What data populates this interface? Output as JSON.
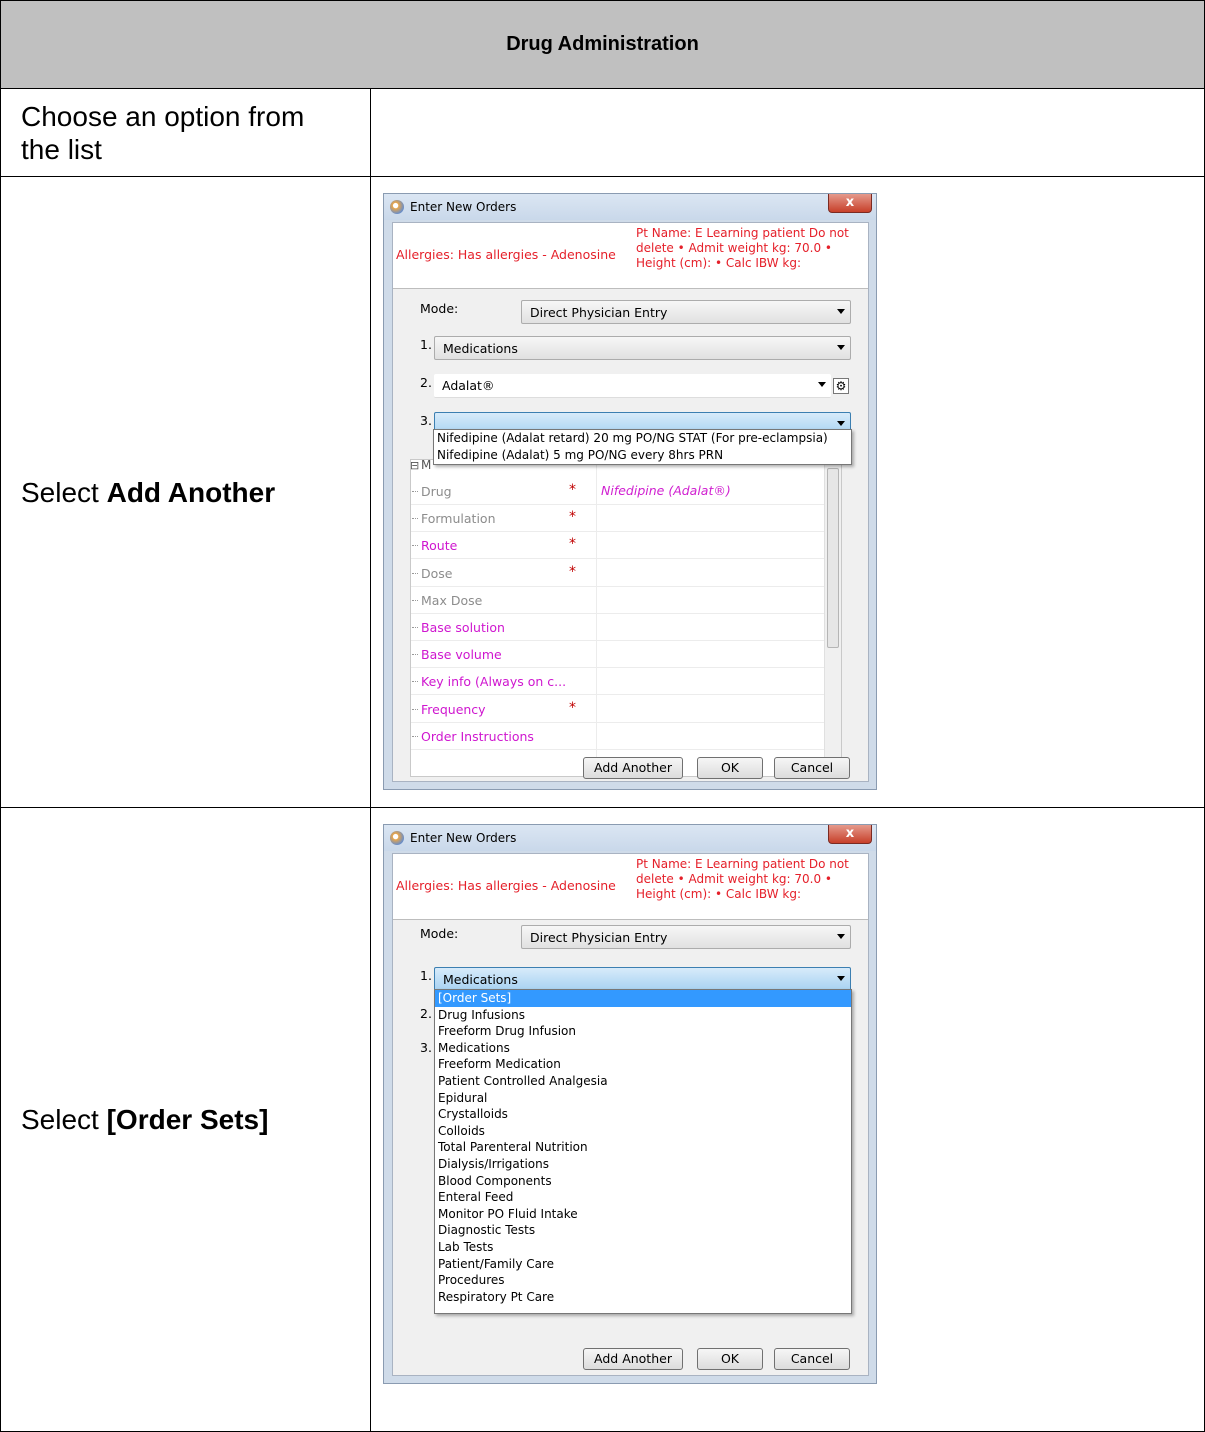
{
  "header": {
    "title": "Drug Administration"
  },
  "rows": [
    {
      "instruction": "Choose an option from the list"
    },
    {
      "instruction_prefix": "Select ",
      "instruction_bold": "Add Another"
    },
    {
      "instruction_prefix": "Select ",
      "instruction_bold": "[Order Sets]"
    }
  ],
  "dialog": {
    "title": "Enter New Orders",
    "close_label": "x",
    "allergies": "Allergies: Has allergies - Adenosine",
    "patient_info": "Pt Name: E Learning patient Do not delete • Admit weight kg: 70.0 • Height (cm): • Calc IBW kg:",
    "mode_label": "Mode:",
    "mode_value": "Direct Physician Entry",
    "step1_label": "1.",
    "step2_label": "2.",
    "step3_label": "3.",
    "buttons": {
      "add_another": "Add Another",
      "ok": "OK",
      "cancel": "Cancel"
    }
  },
  "screen1": {
    "step1_value": "Medications",
    "step2_value": "Adalat®",
    "step3_value": "",
    "step3_options": [
      "Nifedipine (Adalat retard) 20 mg PO/NG STAT (For pre-eclampsia)",
      "Nifedipine (Adalat) 5 mg PO/NG every 8hrs PRN"
    ],
    "grid_group_letter": "M",
    "grid_rows": [
      {
        "label": "Drug",
        "required": "*",
        "value": "Nifedipine (Adalat®)",
        "color": "gray"
      },
      {
        "label": "Formulation",
        "required": "*",
        "value": "",
        "color": "gray"
      },
      {
        "label": "Route",
        "required": "*",
        "value": "",
        "color": "magenta"
      },
      {
        "label": "Dose",
        "required": "*",
        "value": "",
        "color": "gray"
      },
      {
        "label": "Max Dose",
        "required": "",
        "value": "",
        "color": "gray"
      },
      {
        "label": "Base solution",
        "required": "",
        "value": "",
        "color": "magenta"
      },
      {
        "label": "Base volume",
        "required": "",
        "value": "",
        "color": "magenta"
      },
      {
        "label": "Key info (Always on c...",
        "required": "",
        "value": "",
        "color": "magenta"
      },
      {
        "label": "Frequency",
        "required": "*",
        "value": "",
        "color": "magenta"
      },
      {
        "label": "Order Instructions",
        "required": "",
        "value": "",
        "color": "magenta"
      }
    ]
  },
  "screen2": {
    "step1_value": "Medications",
    "category_options": [
      "[Order Sets]",
      "Drug Infusions",
      "Freeform Drug Infusion",
      "Medications",
      "Freeform Medication",
      "Patient Controlled Analgesia",
      "Epidural",
      "Crystalloids",
      "Colloids",
      "Total Parenteral Nutrition",
      "Dialysis/Irrigations",
      "Blood Components",
      "Enteral Feed",
      "Monitor PO Fluid Intake",
      "Diagnostic Tests",
      "Lab Tests",
      "Patient/Family Care",
      "Procedures",
      "Respiratory Pt Care"
    ],
    "highlighted_option": "[Order Sets]"
  }
}
